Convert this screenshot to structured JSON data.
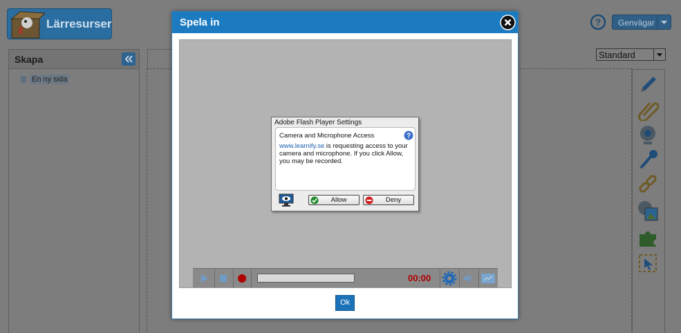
{
  "app": {
    "logo_text": "Lärresurser",
    "shortcuts_label": "Genvägar",
    "left_panel": {
      "title": "Skapa",
      "items": [
        {
          "label": "En ny sida"
        }
      ]
    },
    "view_select": {
      "selected": "Standard"
    },
    "tools": [
      "pencil-icon",
      "paperclip-icon",
      "webcam-icon",
      "microphone-icon",
      "link-icon",
      "image-gallery-icon",
      "puzzle-icon",
      "selection-icon"
    ]
  },
  "modal": {
    "title": "Spela in",
    "ok_label": "Ok",
    "flash": {
      "title": "Adobe Flash Player Settings",
      "heading": "Camera and Microphone Access",
      "link": "www.learnify.se",
      "message": " is requesting access to your camera and microphone. If you click Allow, you may be recorded.",
      "allow_label": "Allow",
      "deny_label": "Deny"
    },
    "player": {
      "time": "00:00"
    }
  },
  "colors": {
    "modal_header": "#1b7ac0",
    "record_red": "#b00000",
    "overlay": "#7d7d7d"
  }
}
